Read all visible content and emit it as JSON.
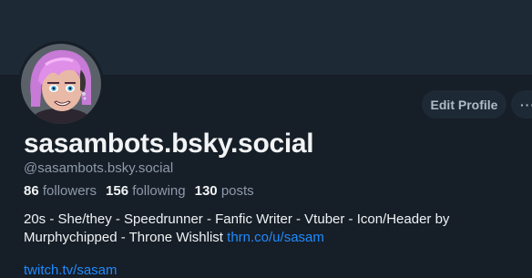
{
  "profile": {
    "display_name": "sasambots.bsky.social",
    "handle": "@sasambots.bsky.social",
    "stats": {
      "followers_count": "86",
      "followers_label": "followers",
      "following_count": "156",
      "following_label": "following",
      "posts_count": "130",
      "posts_label": "posts"
    },
    "bio_line1": "20s - She/they - Speedrunner - Fanfic Writer - Vtuber - Icon/Header by",
    "bio_line2_text": "Murphychipped - Throne Wishlist ",
    "bio_link": "thrn.co/u/sasam",
    "cut_link": "twitch.tv/sasam"
  },
  "actions": {
    "edit_profile_label": "Edit Profile",
    "more_label": "···"
  },
  "colors": {
    "background": "#161e27",
    "banner": "#1e2936",
    "button_bg": "#1e2936",
    "link": "#208bfe",
    "muted_text": "#8d9aab"
  }
}
